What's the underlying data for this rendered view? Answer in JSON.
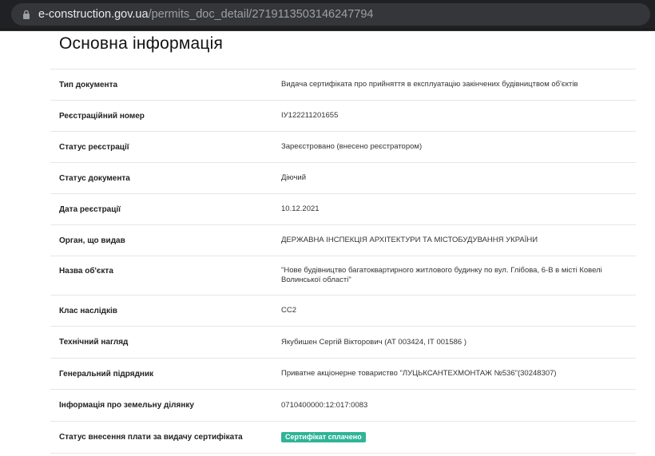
{
  "browser": {
    "url_host": "e-construction.gov.ua",
    "url_path": "/permits_doc_detail/2719113503146247794"
  },
  "section": {
    "title": "Основна інформація"
  },
  "rows": [
    {
      "label": "Тип документа",
      "value": "Видача сертифіката про прийняття в експлуатацію закінчених будівництвом об'єктів"
    },
    {
      "label": "Реєстраційний номер",
      "value": "ІУ122211201655"
    },
    {
      "label": "Статус реєстрації",
      "value": "Зареєстровано (внесено реєстратором)"
    },
    {
      "label": "Статус документа",
      "value": "Діючий"
    },
    {
      "label": "Дата реєстрації",
      "value": "10.12.2021"
    },
    {
      "label": "Орган, що видав",
      "value": "ДЕРЖАВНА ІНСПЕКЦІЯ АРХІТЕКТУРИ ТА МІСТОБУДУВАННЯ УКРАЇНИ"
    },
    {
      "label": "Назва об'єкта",
      "value": "\"Нове будівництво багатоквартирного житлового будинку по вул. Глібова, 6-В в місті Ковелі Волинської області\""
    },
    {
      "label": "Клас наслідків",
      "value": "СС2"
    },
    {
      "label": "Технічний нагляд",
      "value": "Якубишен Сергій Вікторович (АТ 003424, ІТ 001586 )"
    },
    {
      "label": "Генеральний підрядник",
      "value": "Приватне акціонерне товариство \"ЛУЦЬКСАНТЕХМОНТАЖ №536\"(30248307)"
    },
    {
      "label": "Інформація про земельну ділянку",
      "value": "0710400000:12:017:0083"
    },
    {
      "label": "Статус внесення плати за видачу сертифіката",
      "value": "Сертифікат сплачено"
    }
  ],
  "colors": {
    "badge": "#2fb497",
    "toolbar": "#202124"
  },
  "icons": {
    "url_lock": "lock-icon"
  }
}
